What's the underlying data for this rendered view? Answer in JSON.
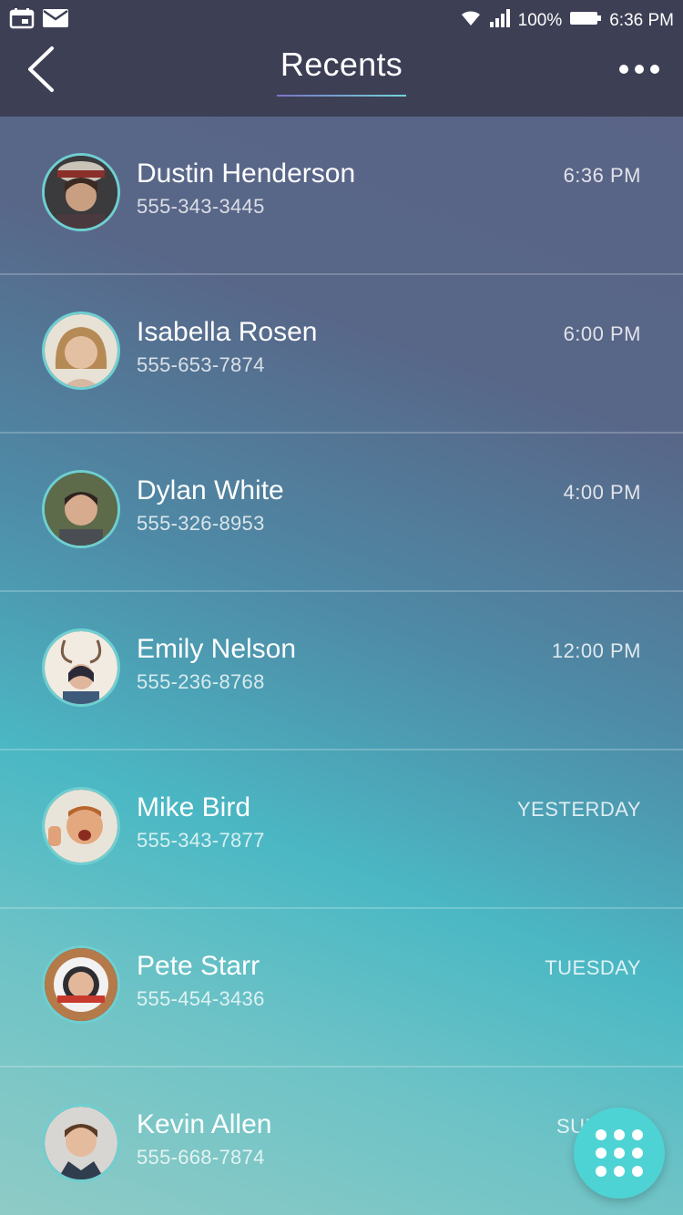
{
  "status_bar": {
    "battery": "100%",
    "time": "6:36 PM",
    "icons": [
      "calendar-icon",
      "mail-icon",
      "wifi-icon",
      "signal-icon",
      "battery-icon"
    ]
  },
  "header": {
    "title": "Recents",
    "back_icon": "chevron-left-icon",
    "more_icon": "more-dots-icon"
  },
  "contacts": [
    {
      "name": "Dustin Henderson",
      "phone": "555-343-3445",
      "time": "6:36 PM"
    },
    {
      "name": "Isabella Rosen",
      "phone": "555-653-7874",
      "time": "6:00 PM"
    },
    {
      "name": "Dylan White",
      "phone": "555-326-8953",
      "time": "4:00 PM"
    },
    {
      "name": "Emily Nelson",
      "phone": "555-236-8768",
      "time": "12:00 PM"
    },
    {
      "name": "Mike Bird",
      "phone": "555-343-7877",
      "time": "YESTERDAY"
    },
    {
      "name": "Pete Starr",
      "phone": "555-454-3436",
      "time": "TUESDAY"
    },
    {
      "name": "Kevin Allen",
      "phone": "555-668-7874",
      "time": "SUNDAY"
    }
  ],
  "fab": {
    "icon": "dialpad-icon"
  },
  "colors": {
    "accent": "#4ed3d4",
    "header_bg": "#3d3f55",
    "avatar_ring": "#6fcfd0"
  }
}
